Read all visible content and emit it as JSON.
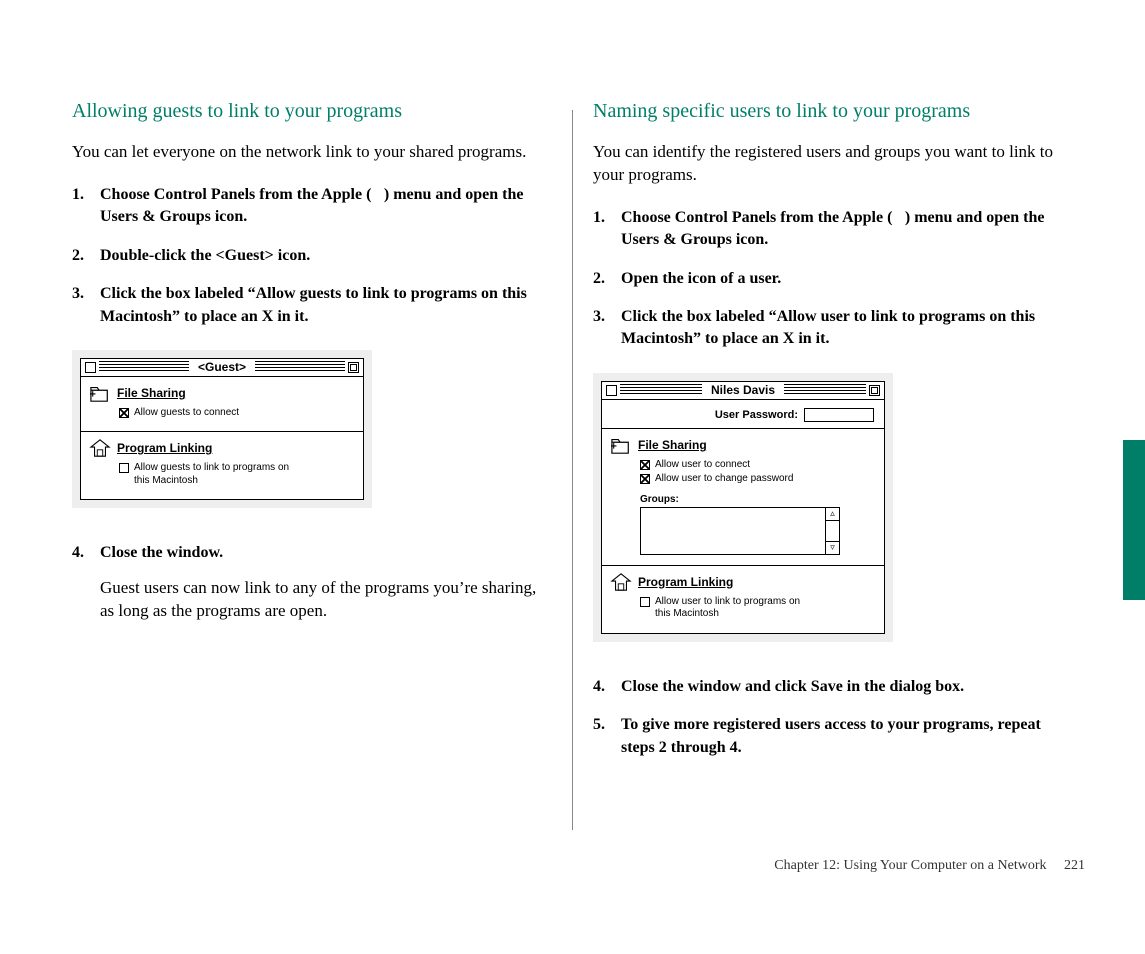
{
  "left": {
    "heading": "Allowing guests to link to your programs",
    "intro": "You can let everyone on the network link to your shared programs.",
    "steps": [
      "Choose Control Panels from the Apple () menu and open the Users & Groups icon.",
      "Double-click the <Guest> icon.",
      "Click the box labeled “Allow guests to link to programs on this Macintosh” to place an X in it.",
      "Close the window."
    ],
    "step4_note": "Guest users can now link to any of the programs you’re sharing, as long as the programs are open.",
    "screenshot": {
      "title": "<Guest>",
      "file_sharing_label": "File Sharing",
      "cb1": "Allow guests to connect",
      "program_linking_label": "Program Linking",
      "cb2": "Allow guests to link to programs on this Macintosh"
    }
  },
  "right": {
    "heading": "Naming specific users to link to your programs",
    "intro": "You can identify the registered users and groups you want to link to your programs.",
    "steps": [
      "Choose Control Panels from the Apple () menu and open the Users & Groups icon.",
      "Open the icon of a user.",
      "Click the box labeled “Allow user to link to programs on this Macintosh” to place an X in it.",
      "Close the window and click Save in the dialog box.",
      "To give more registered users access to your programs, repeat steps 2 through 4."
    ],
    "screenshot": {
      "title": "Niles Davis",
      "pw_label": "User Password:",
      "file_sharing_label": "File Sharing",
      "cb1": "Allow user to connect",
      "cb2": "Allow user to change password",
      "groups_label": "Groups:",
      "program_linking_label": "Program Linking",
      "cb3": "Allow user to link to programs on this Macintosh"
    }
  },
  "footer": {
    "chapter": "Chapter 12: Using Your Computer on a Network",
    "page": "221"
  }
}
